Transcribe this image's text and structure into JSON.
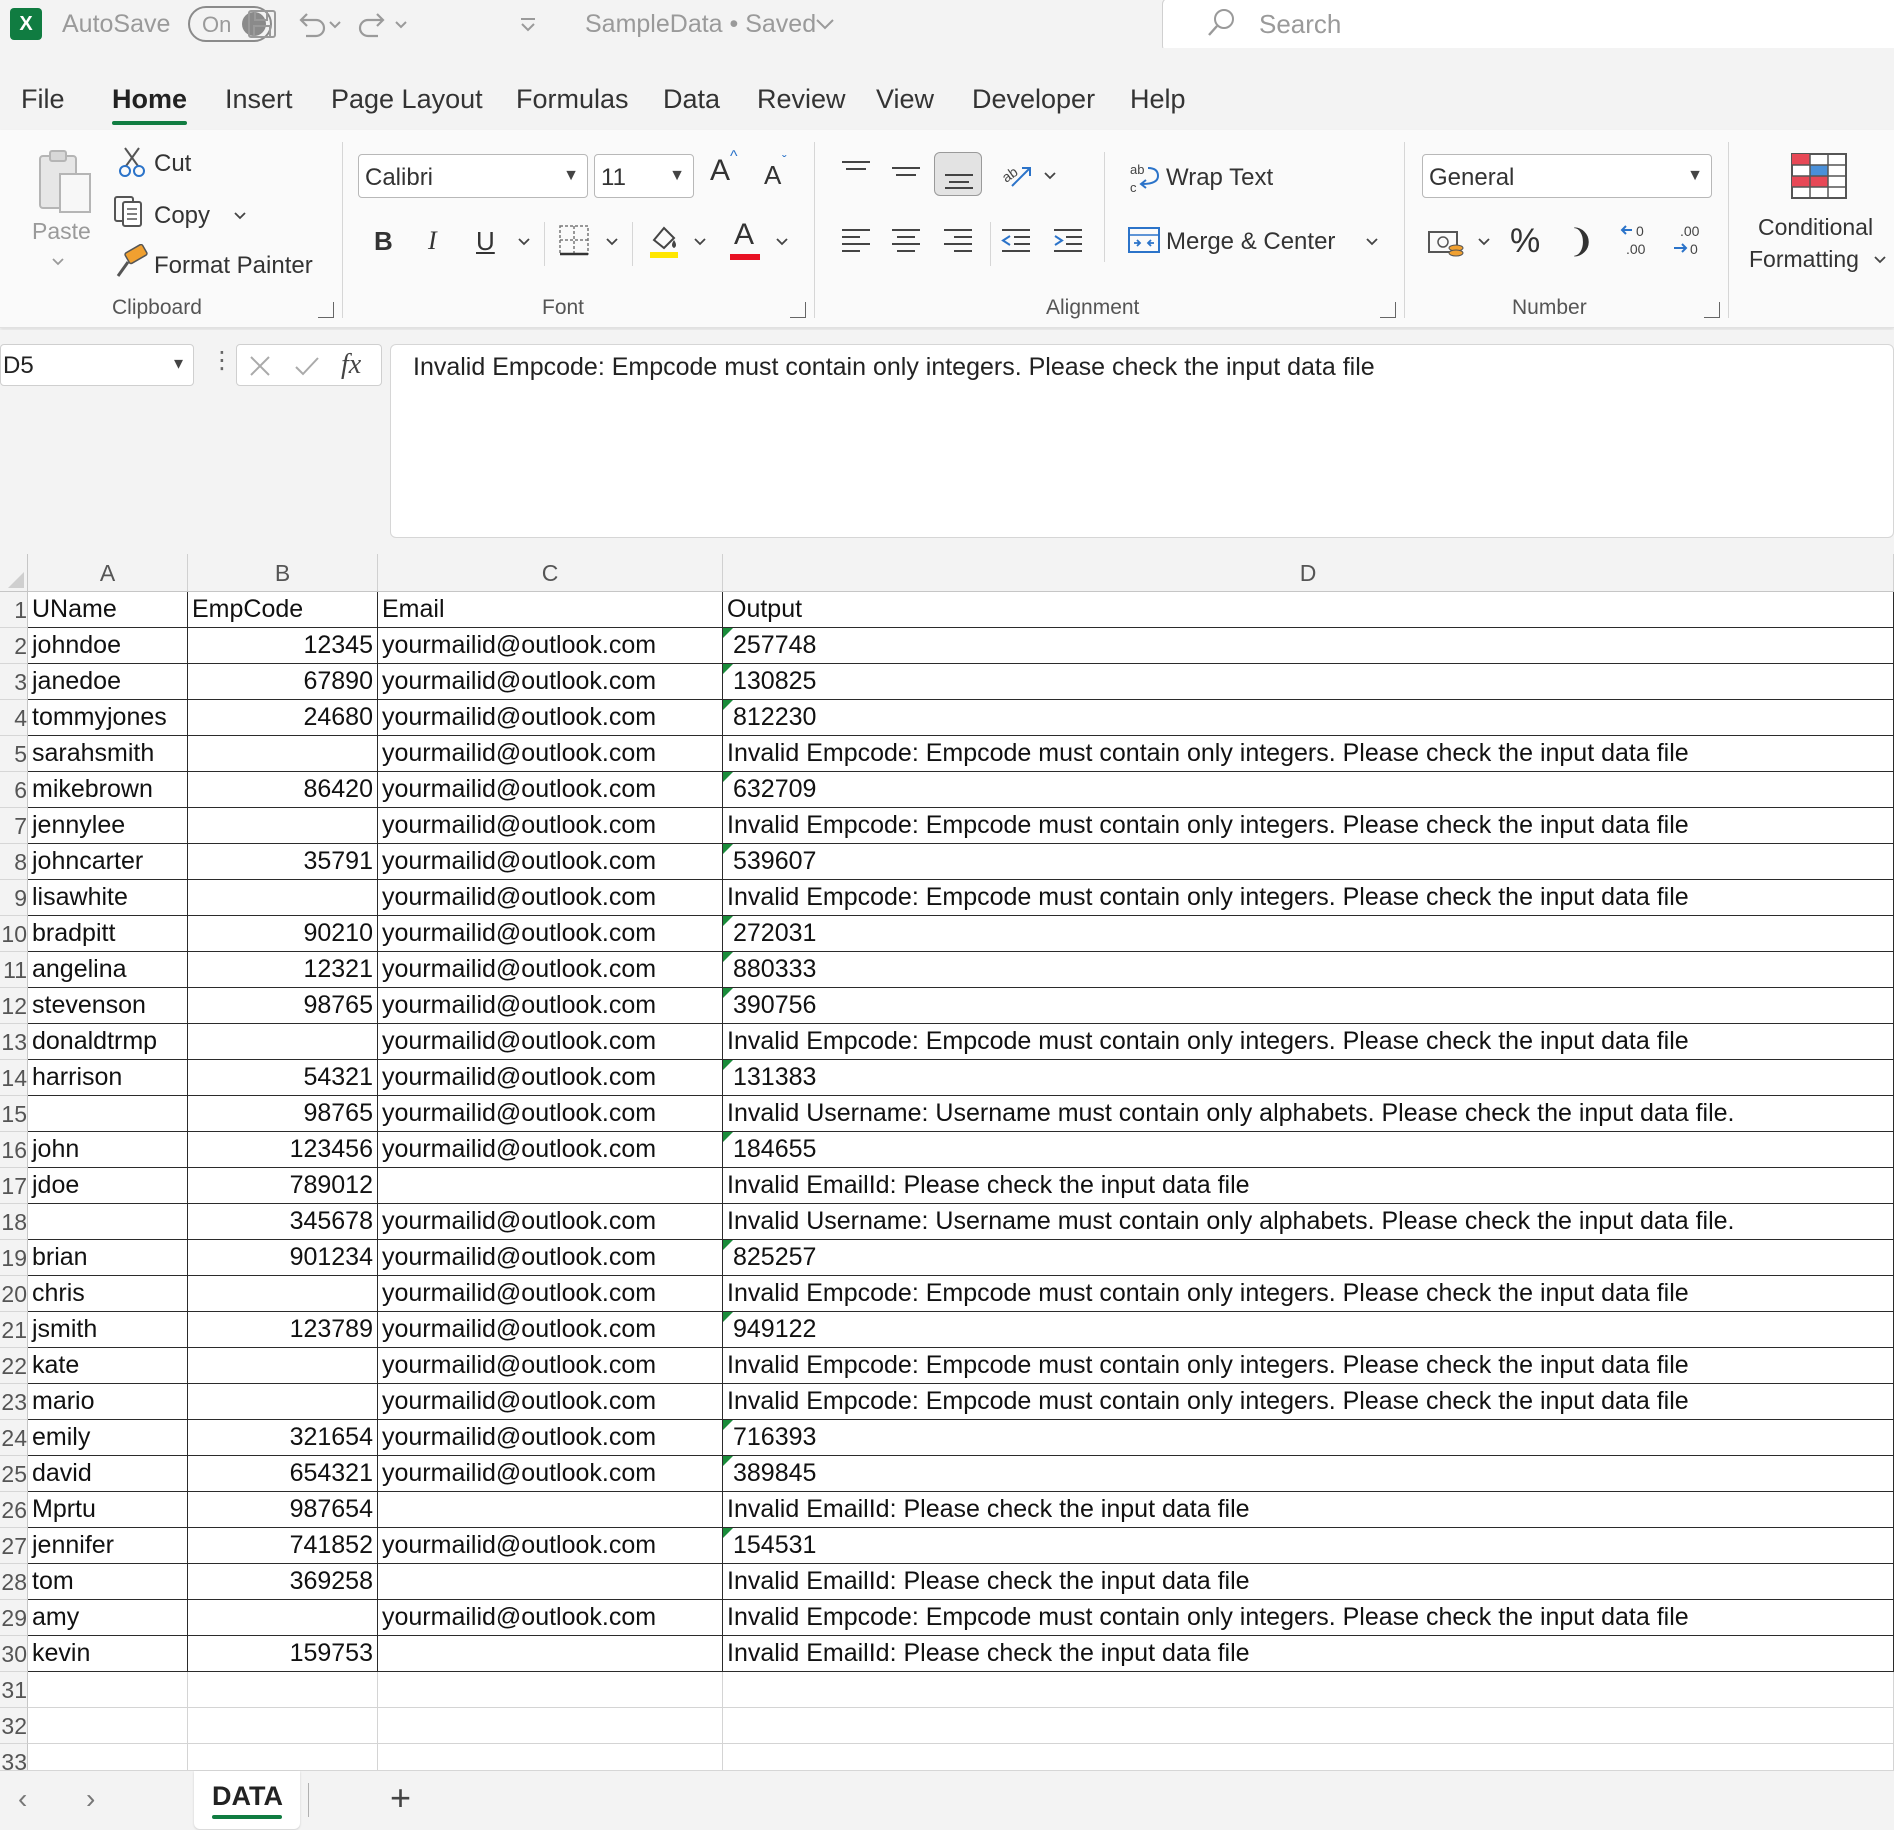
{
  "titlebar": {
    "autosave_label": "AutoSave",
    "autosave_state": "On",
    "doc_title": "SampleData • Saved",
    "search_placeholder": "Search"
  },
  "menu": {
    "tabs": [
      "File",
      "Home",
      "Insert",
      "Page Layout",
      "Formulas",
      "Data",
      "Review",
      "View",
      "Developer",
      "Help"
    ],
    "active": "Home"
  },
  "ribbon": {
    "clipboard": {
      "paste": "Paste",
      "cut": "Cut",
      "copy": "Copy",
      "format_painter": "Format Painter",
      "label": "Clipboard"
    },
    "font": {
      "family": "Calibri",
      "size": "11",
      "label": "Font",
      "bold": "B",
      "italic": "I",
      "underline": "U",
      "font_color_letter": "A",
      "grow_letter": "A",
      "shrink_letter": "A"
    },
    "alignment": {
      "wrap_text": "Wrap Text",
      "merge_center": "Merge & Center",
      "label": "Alignment"
    },
    "number": {
      "format": "General",
      "label": "Number",
      "percent": "%",
      "comma": "❩"
    },
    "styles": {
      "conditional_line1": "Conditional",
      "conditional_line2": "Formatting"
    }
  },
  "formula_bar": {
    "name_box": "D5",
    "fx": "fx",
    "content": "Invalid Empcode: Empcode must contain only integers. Please check the input data file"
  },
  "sheet": {
    "columns": [
      "A",
      "B",
      "C",
      "D"
    ],
    "row_numbers": [
      "1",
      "2",
      "3",
      "4",
      "5",
      "6",
      "7",
      "8",
      "9",
      "10",
      "11",
      "12",
      "13",
      "14",
      "15",
      "16",
      "17",
      "18",
      "19",
      "20",
      "21",
      "22",
      "23",
      "24",
      "25",
      "26",
      "27",
      "28",
      "29",
      "30",
      "31",
      "32",
      "33"
    ],
    "header": [
      "UName",
      "EmpCode",
      "Email",
      "Output"
    ],
    "rows": [
      [
        "johndoe",
        "12345",
        "yourmailid@outlook.com",
        "257748"
      ],
      [
        "janedoe",
        "67890",
        "yourmailid@outlook.com",
        "130825"
      ],
      [
        "tommyjones",
        "24680",
        "yourmailid@outlook.com",
        "812230"
      ],
      [
        "sarahsmith",
        "",
        "yourmailid@outlook.com",
        "Invalid Empcode: Empcode must contain only integers. Please check the input data file"
      ],
      [
        "mikebrown",
        "86420",
        "yourmailid@outlook.com",
        "632709"
      ],
      [
        "jennylee",
        "",
        "yourmailid@outlook.com",
        "Invalid Empcode: Empcode must contain only integers. Please check the input data file"
      ],
      [
        "johncarter",
        "35791",
        "yourmailid@outlook.com",
        "539607"
      ],
      [
        "lisawhite",
        "",
        "yourmailid@outlook.com",
        "Invalid Empcode: Empcode must contain only integers. Please check the input data file"
      ],
      [
        "bradpitt",
        "90210",
        "yourmailid@outlook.com",
        "272031"
      ],
      [
        "angelina",
        "12321",
        "yourmailid@outlook.com",
        "880333"
      ],
      [
        "stevenson",
        "98765",
        "yourmailid@outlook.com",
        "390756"
      ],
      [
        "donaldtrmp",
        "",
        "yourmailid@outlook.com",
        "Invalid Empcode: Empcode must contain only integers. Please check the input data file"
      ],
      [
        "harrison",
        "54321",
        "yourmailid@outlook.com",
        "131383"
      ],
      [
        "",
        "98765",
        "yourmailid@outlook.com",
        "Invalid Username: Username must contain only alphabets. Please check the input data file."
      ],
      [
        "john",
        "123456",
        "yourmailid@outlook.com",
        "184655"
      ],
      [
        "jdoe",
        "789012",
        "",
        "Invalid EmailId: Please check the input data file"
      ],
      [
        "",
        "345678",
        "yourmailid@outlook.com",
        "Invalid Username: Username must contain only alphabets. Please check the input data file."
      ],
      [
        "brian",
        "901234",
        "yourmailid@outlook.com",
        "825257"
      ],
      [
        "chris",
        "",
        "yourmailid@outlook.com",
        "Invalid Empcode: Empcode must contain only integers. Please check the input data file"
      ],
      [
        "jsmith",
        "123789",
        "yourmailid@outlook.com",
        "949122"
      ],
      [
        "kate",
        "",
        "yourmailid@outlook.com",
        "Invalid Empcode: Empcode must contain only integers. Please check the input data file"
      ],
      [
        "mario",
        "",
        "yourmailid@outlook.com",
        "Invalid Empcode: Empcode must contain only integers. Please check the input data file"
      ],
      [
        "emily",
        "321654",
        "yourmailid@outlook.com",
        "716393"
      ],
      [
        "david",
        "654321",
        "yourmailid@outlook.com",
        "389845"
      ],
      [
        "Mprtu",
        "987654",
        "",
        "Invalid EmailId: Please check the input data file"
      ],
      [
        "jennifer",
        "741852",
        "yourmailid@outlook.com",
        "154531"
      ],
      [
        "tom",
        "369258",
        "",
        "Invalid EmailId: Please check the input data file"
      ],
      [
        "amy",
        "",
        "yourmailid@outlook.com",
        "Invalid Empcode: Empcode must contain only integers. Please check the input data file"
      ],
      [
        "kevin",
        "159753",
        "",
        "Invalid EmailId: Please check the input data file"
      ]
    ]
  },
  "sheet_tabs": {
    "active": "DATA",
    "add": "+"
  },
  "colors": {
    "excel_green": "#107c41",
    "error_indicator": "#1a8c3a"
  }
}
